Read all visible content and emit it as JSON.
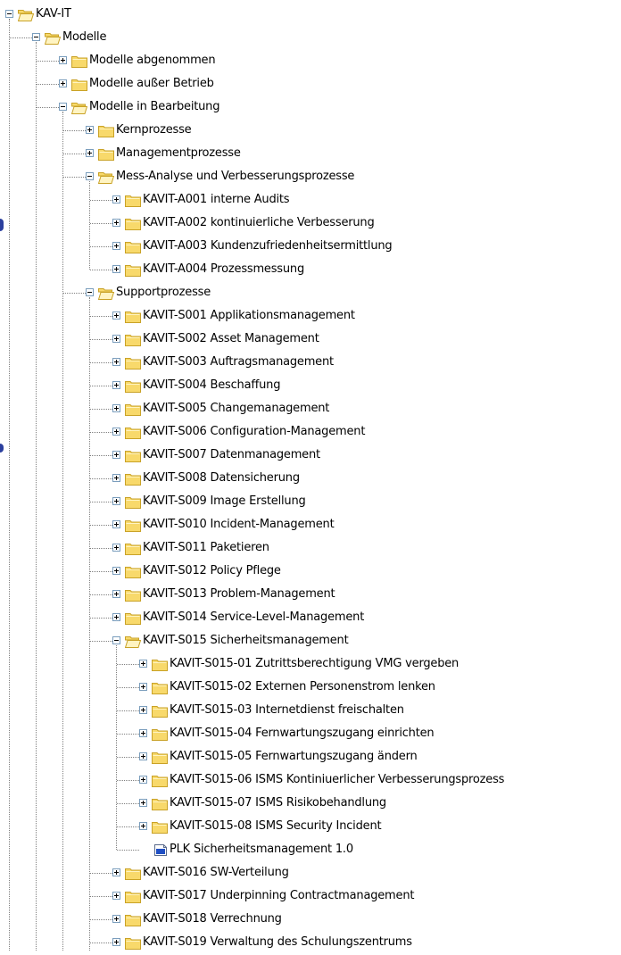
{
  "tree": {
    "items": [
      {
        "label": "KAV-IT",
        "depth": 0,
        "state": "open",
        "icon": "folder-open-icon"
      },
      {
        "label": "Modelle",
        "depth": 1,
        "state": "open",
        "icon": "folder-open-icon"
      },
      {
        "label": "Modelle abgenommen",
        "depth": 2,
        "state": "closed",
        "icon": "folder-icon"
      },
      {
        "label": "Modelle außer Betrieb",
        "depth": 2,
        "state": "closed",
        "icon": "folder-icon"
      },
      {
        "label": "Modelle in Bearbeitung",
        "depth": 2,
        "state": "open",
        "icon": "folder-open-icon"
      },
      {
        "label": "Kernprozesse",
        "depth": 3,
        "state": "closed",
        "icon": "folder-icon"
      },
      {
        "label": "Managementprozesse",
        "depth": 3,
        "state": "closed",
        "icon": "folder-icon"
      },
      {
        "label": "Mess-Analyse und Verbesserungsprozesse",
        "depth": 3,
        "state": "open",
        "icon": "folder-open-icon"
      },
      {
        "label": "KAVIT-A001 interne Audits",
        "depth": 4,
        "state": "closed",
        "icon": "folder-icon"
      },
      {
        "label": "KAVIT-A002 kontinuierliche Verbesserung",
        "depth": 4,
        "state": "closed",
        "icon": "folder-icon"
      },
      {
        "label": "KAVIT-A003 Kundenzufriedenheitsermittlung",
        "depth": 4,
        "state": "closed",
        "icon": "folder-icon"
      },
      {
        "label": "KAVIT-A004 Prozessmessung",
        "depth": 4,
        "state": "closed",
        "icon": "folder-icon"
      },
      {
        "label": "Supportprozesse",
        "depth": 3,
        "state": "open",
        "icon": "folder-open-icon"
      },
      {
        "label": "KAVIT-S001 Applikationsmanagement",
        "depth": 4,
        "state": "closed",
        "icon": "folder-icon"
      },
      {
        "label": "KAVIT-S002 Asset Management",
        "depth": 4,
        "state": "closed",
        "icon": "folder-icon"
      },
      {
        "label": "KAVIT-S003 Auftragsmanagement",
        "depth": 4,
        "state": "closed",
        "icon": "folder-icon"
      },
      {
        "label": "KAVIT-S004 Beschaffung",
        "depth": 4,
        "state": "closed",
        "icon": "folder-icon"
      },
      {
        "label": "KAVIT-S005 Changemanagement",
        "depth": 4,
        "state": "closed",
        "icon": "folder-icon"
      },
      {
        "label": "KAVIT-S006 Configuration-Management",
        "depth": 4,
        "state": "closed",
        "icon": "folder-icon"
      },
      {
        "label": "KAVIT-S007 Datenmanagement",
        "depth": 4,
        "state": "closed",
        "icon": "folder-icon"
      },
      {
        "label": "KAVIT-S008 Datensicherung",
        "depth": 4,
        "state": "closed",
        "icon": "folder-icon"
      },
      {
        "label": "KAVIT-S009 Image Erstellung",
        "depth": 4,
        "state": "closed",
        "icon": "folder-icon"
      },
      {
        "label": "KAVIT-S010 Incident-Management",
        "depth": 4,
        "state": "closed",
        "icon": "folder-icon"
      },
      {
        "label": "KAVIT-S011 Paketieren",
        "depth": 4,
        "state": "closed",
        "icon": "folder-icon"
      },
      {
        "label": "KAVIT-S012 Policy Pflege",
        "depth": 4,
        "state": "closed",
        "icon": "folder-icon"
      },
      {
        "label": "KAVIT-S013 Problem-Management",
        "depth": 4,
        "state": "closed",
        "icon": "folder-icon"
      },
      {
        "label": "KAVIT-S014 Service-Level-Management",
        "depth": 4,
        "state": "closed",
        "icon": "folder-icon"
      },
      {
        "label": "KAVIT-S015 Sicherheitsmanagement",
        "depth": 4,
        "state": "open",
        "icon": "folder-open-icon"
      },
      {
        "label": "KAVIT-S015-01 Zutrittsberechtigung VMG vergeben",
        "depth": 5,
        "state": "closed",
        "icon": "folder-icon"
      },
      {
        "label": "KAVIT-S015-02 Externen Personenstrom lenken",
        "depth": 5,
        "state": "closed",
        "icon": "folder-icon"
      },
      {
        "label": "KAVIT-S015-03 Internetdienst freischalten",
        "depth": 5,
        "state": "closed",
        "icon": "folder-icon"
      },
      {
        "label": "KAVIT-S015-04 Fernwartungszugang einrichten",
        "depth": 5,
        "state": "closed",
        "icon": "folder-icon"
      },
      {
        "label": "KAVIT-S015-05 Fernwartungszugang ändern",
        "depth": 5,
        "state": "closed",
        "icon": "folder-icon"
      },
      {
        "label": "KAVIT-S015-06 ISMS Kontiniuerlicher Verbesserungsprozess",
        "depth": 5,
        "state": "closed",
        "icon": "folder-icon"
      },
      {
        "label": "KAVIT-S015-07 ISMS Risikobehandlung",
        "depth": 5,
        "state": "closed",
        "icon": "folder-icon"
      },
      {
        "label": "KAVIT-S015-08 ISMS Security Incident",
        "depth": 5,
        "state": "closed",
        "icon": "folder-icon"
      },
      {
        "label": "PLK Sicherheitsmanagement 1.0",
        "depth": 5,
        "state": "leaf",
        "icon": "model-document-icon"
      },
      {
        "label": "KAVIT-S016 SW-Verteilung",
        "depth": 4,
        "state": "closed",
        "icon": "folder-icon"
      },
      {
        "label": "KAVIT-S017 Underpinning Contractmanagement",
        "depth": 4,
        "state": "closed",
        "icon": "folder-icon"
      },
      {
        "label": "KAVIT-S018 Verrechnung",
        "depth": 4,
        "state": "closed",
        "icon": "folder-icon"
      },
      {
        "label": "KAVIT-S019 Verwaltung des Schulungszentrums",
        "depth": 4,
        "state": "closed",
        "icon": "folder-icon"
      }
    ]
  },
  "colors": {
    "folder_fill": "#f8d96b",
    "folder_edge": "#c9a227",
    "folder_inner": "#fff4c2",
    "expander_border": "#7b9ebd",
    "guide_line": "#808080",
    "doc_blue": "#1f4fc4"
  }
}
